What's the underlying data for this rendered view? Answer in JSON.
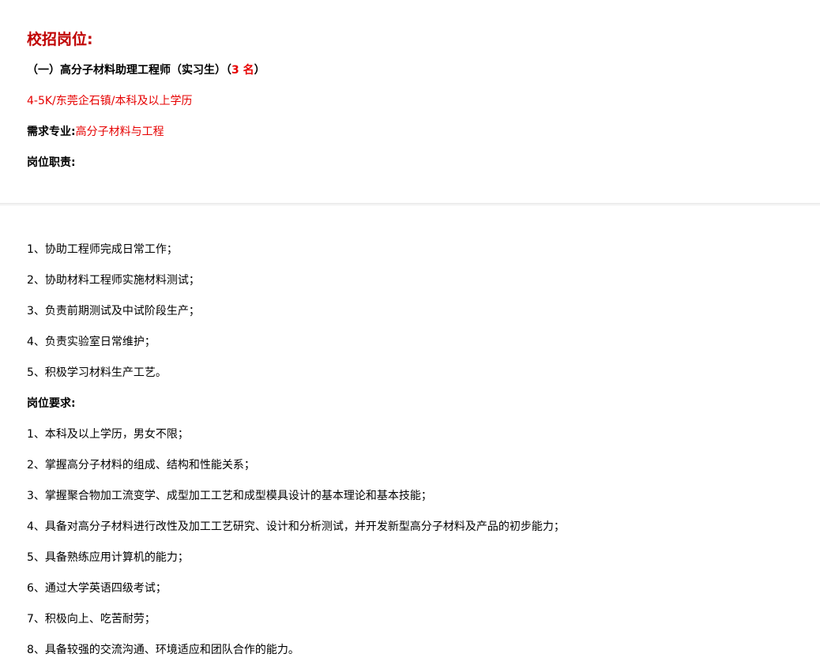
{
  "colors": {
    "accent_red": "#e60000",
    "heading_red": "#c00000",
    "text": "#000000"
  },
  "header": {
    "title": "校招岗位:",
    "position_title": "（一）高分子材料助理工程师（实习生）（",
    "position_count": "3 名",
    "position_close": "）",
    "salary_location_edu": "4-5K/东莞企石镇/本科及以上学历",
    "major_label": "需求专业:",
    "major_value": "高分子材料与工程",
    "duties_label": "岗位职责:"
  },
  "duties": [
    "1、协助工程师完成日常工作；",
    "2、协助材料工程师实施材料测试；",
    "3、负责前期测试及中试阶段生产；",
    "4、负责实验室日常维护；",
    "5、积极学习材料生产工艺。"
  ],
  "requirements_label": "岗位要求:",
  "requirements": [
    "1、本科及以上学历，男女不限；",
    "2、掌握高分子材料的组成、结构和性能关系；",
    "3、掌握聚合物加工流变学、成型加工工艺和成型模具设计的基本理论和基本技能；",
    "4、具备对高分子材料进行改性及加工工艺研究、设计和分析测试，并开发新型高分子材料及产品的初步能力；",
    "5、具备熟练应用计算机的能力；",
    "6、通过大学英语四级考试；",
    "7、积极向上、吃苦耐劳；",
    "8、具备较强的交流沟通、环境适应和团队合作的能力。"
  ]
}
